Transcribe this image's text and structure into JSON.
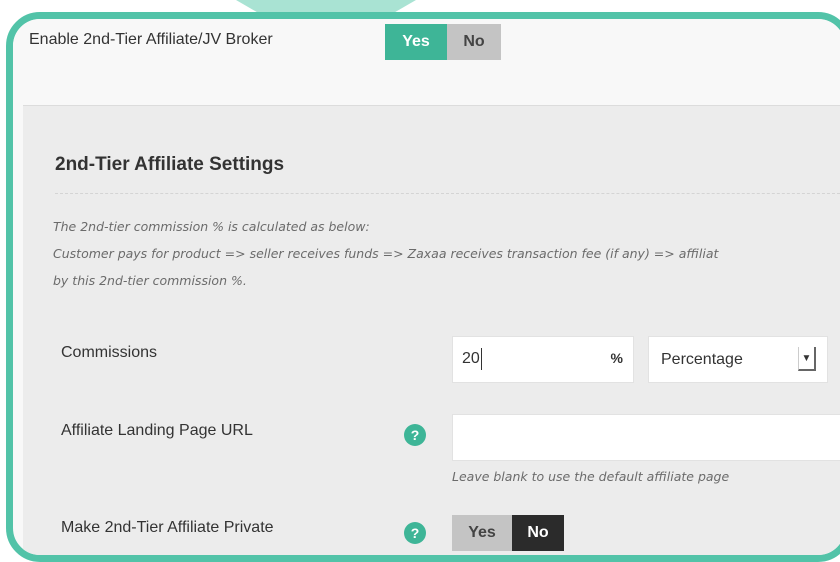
{
  "enable": {
    "label": "Enable 2nd-Tier Affiliate/JV Broker",
    "yes": "Yes",
    "no": "No",
    "selected": "Yes"
  },
  "panel": {
    "title": "2nd-Tier Affiliate Settings",
    "note_lines": [
      "The 2nd-tier commission % is calculated as below:",
      "Customer pays for product => seller receives funds => Zaxaa receives transaction fee (if any) => affiliat",
      "by this 2nd-tier commission %."
    ]
  },
  "commissions": {
    "label": "Commissions",
    "value": "20",
    "unit": "%",
    "type": "Percentage"
  },
  "landing": {
    "label": "Affiliate Landing Page URL",
    "value": "",
    "hint": "Leave blank to use the default affiliate page",
    "help": "?"
  },
  "private": {
    "label": "Make 2nd-Tier Affiliate Private",
    "yes": "Yes",
    "no": "No",
    "selected": "No",
    "help": "?"
  },
  "colors": {
    "accent": "#3eb597",
    "frame": "#52c3a8",
    "dark": "#2b2b2b"
  }
}
